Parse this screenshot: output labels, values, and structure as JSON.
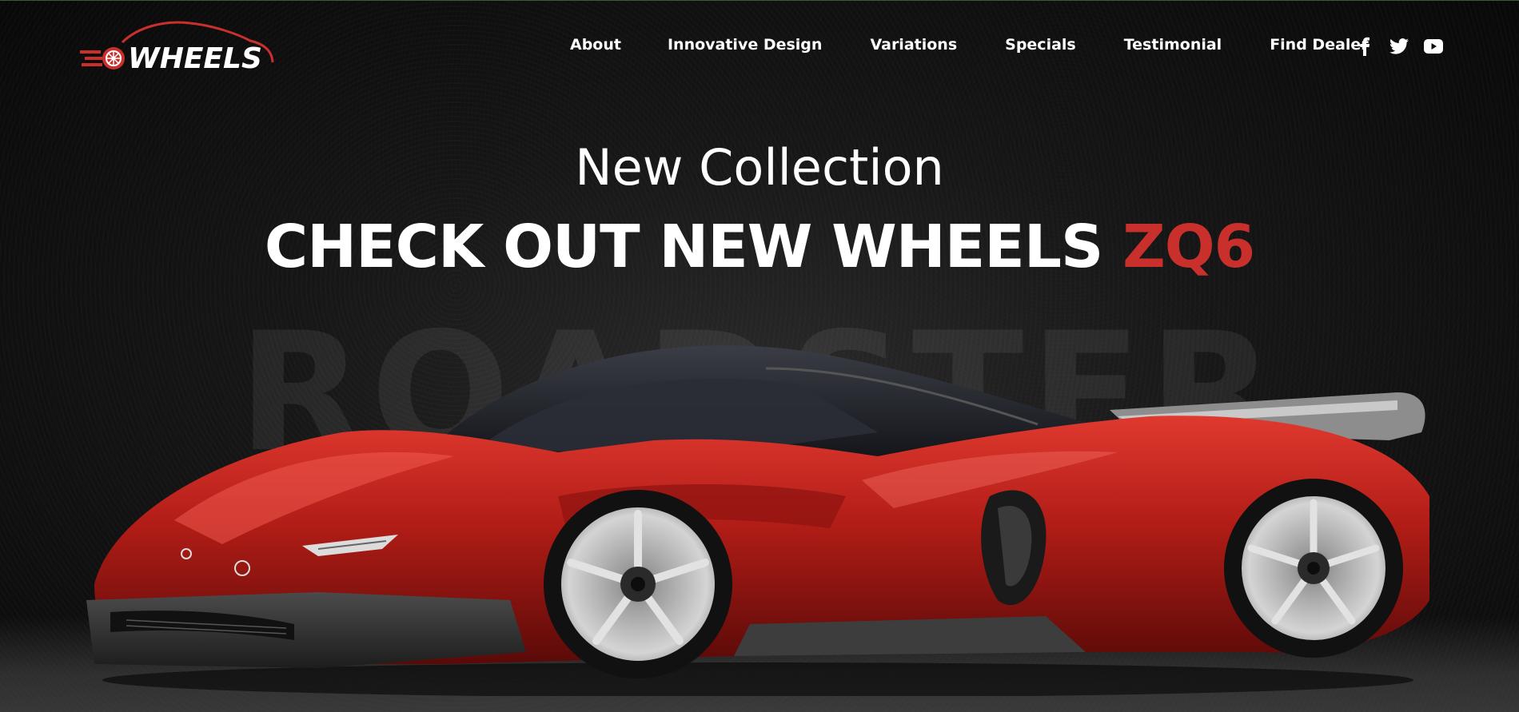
{
  "brand": {
    "name": "WHEELS"
  },
  "nav": {
    "items": [
      {
        "label": "About"
      },
      {
        "label": "Innovative Design"
      },
      {
        "label": "Variations"
      },
      {
        "label": "Specials"
      },
      {
        "label": "Testimonial"
      },
      {
        "label": "Find Dealer"
      }
    ]
  },
  "social": {
    "icons": [
      "facebook-icon",
      "twitter-icon",
      "youtube-icon"
    ]
  },
  "hero": {
    "subtitle": "New Collection",
    "headline_main": "CHECK OUT NEW WHEELS",
    "headline_accent": "ZQ6",
    "background_word": "ROADSTER",
    "image": "red-sports-car"
  },
  "colors": {
    "accent": "#c9302c",
    "background": "#0b0b0b",
    "text": "#ffffff"
  }
}
